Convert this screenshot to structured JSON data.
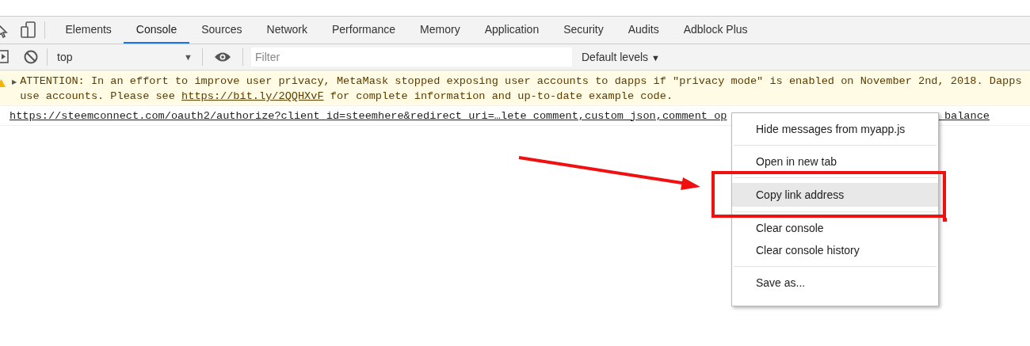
{
  "tabs": [
    {
      "label": "Elements",
      "selected": false
    },
    {
      "label": "Console",
      "selected": true
    },
    {
      "label": "Sources",
      "selected": false
    },
    {
      "label": "Network",
      "selected": false
    },
    {
      "label": "Performance",
      "selected": false
    },
    {
      "label": "Memory",
      "selected": false
    },
    {
      "label": "Application",
      "selected": false
    },
    {
      "label": "Security",
      "selected": false
    },
    {
      "label": "Audits",
      "selected": false
    },
    {
      "label": "Adblock Plus",
      "selected": false
    }
  ],
  "context_select": {
    "value": "top",
    "arrow": "▼"
  },
  "filter": {
    "placeholder": "Filter"
  },
  "levels": {
    "label": "Default levels",
    "arrow": "▼"
  },
  "messages": [
    {
      "kind": "warning",
      "expand": "▶",
      "line_1": "ATTENTION: In an effort to improve user privacy, MetaMask stopped exposing user accounts to dapps if \"privacy mode\" is enabled on November 2nd, 2018. Dapps",
      "line_2_before": "use accounts. Please see ",
      "link": "https://bit.ly/2QQHXvF",
      "line_2_after": " for complete information and up-to-date example code."
    },
    {
      "kind": "link",
      "url_start": "https://steemconnect.com/oauth2/authorize?client_id=steemhere&redirect_uri=…lete_comment,custom_json,comment_op",
      "url_end": "_balance"
    }
  ],
  "context_menu": [
    {
      "kind": "item",
      "label": "Hide messages from myapp.js",
      "selected": false
    },
    {
      "kind": "separator"
    },
    {
      "kind": "item",
      "label": "Open in new tab",
      "selected": false
    },
    {
      "kind": "separator"
    },
    {
      "kind": "item",
      "label": "Copy link address",
      "selected": true
    },
    {
      "kind": "separator"
    },
    {
      "kind": "item",
      "label": "Clear console",
      "selected": false
    },
    {
      "kind": "item",
      "label": "Clear console history",
      "selected": false
    },
    {
      "kind": "separator"
    },
    {
      "kind": "item",
      "label": "Save as...",
      "selected": false
    }
  ]
}
